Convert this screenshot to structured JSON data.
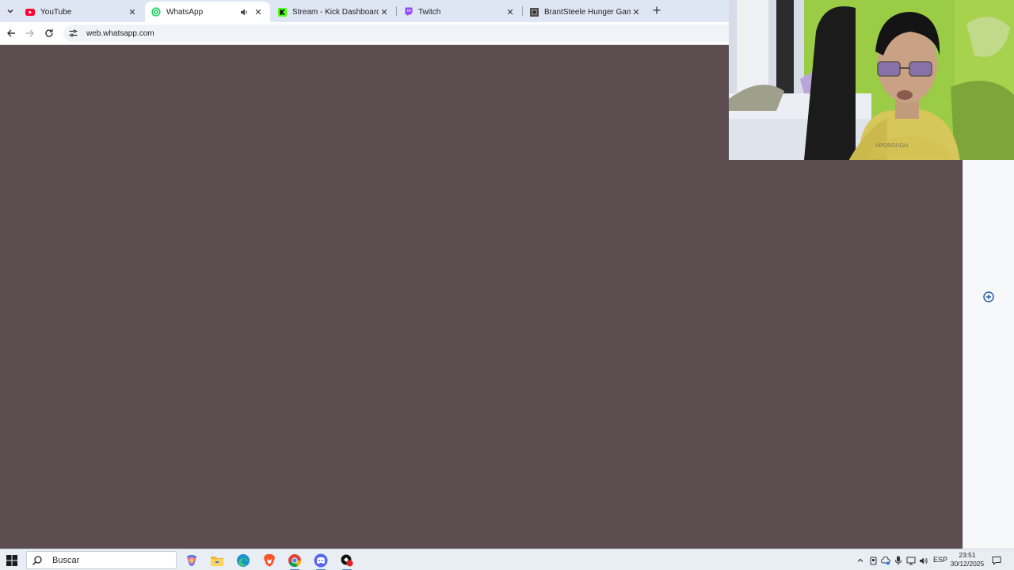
{
  "browser": {
    "tabs": [
      {
        "title": "YouTube",
        "icon": "youtube-icon",
        "active": false
      },
      {
        "title": "WhatsApp",
        "icon": "whatsapp-icon",
        "active": true,
        "audio": true
      },
      {
        "title": "Stream - Kick Dashboard",
        "icon": "kick-icon",
        "active": false
      },
      {
        "title": "Twitch",
        "icon": "twitch-icon",
        "active": false
      },
      {
        "title": "BrantSteele Hunger Games Simulator",
        "icon": "brantsteele-icon",
        "active": false
      }
    ],
    "url": "web.whatsapp.com"
  },
  "page": {
    "background_color": "#5b4d50",
    "side_panel_icon": "add-circle-icon"
  },
  "taskbar": {
    "search_placeholder": "Buscar",
    "apps": [
      "copilot-icon",
      "file-explorer-icon",
      "edge-icon",
      "brave-icon",
      "chrome-icon",
      "discord-icon",
      "app-icon"
    ],
    "language": "ESP",
    "time": "23:51",
    "date": "30/12/2025"
  },
  "colors": {
    "tabstrip": "#dfe6f3",
    "accent": "#1f6feb",
    "whatsapp": "#25d366",
    "youtube": "#ff0033",
    "kick": "#53fc18",
    "twitch": "#9146ff"
  }
}
